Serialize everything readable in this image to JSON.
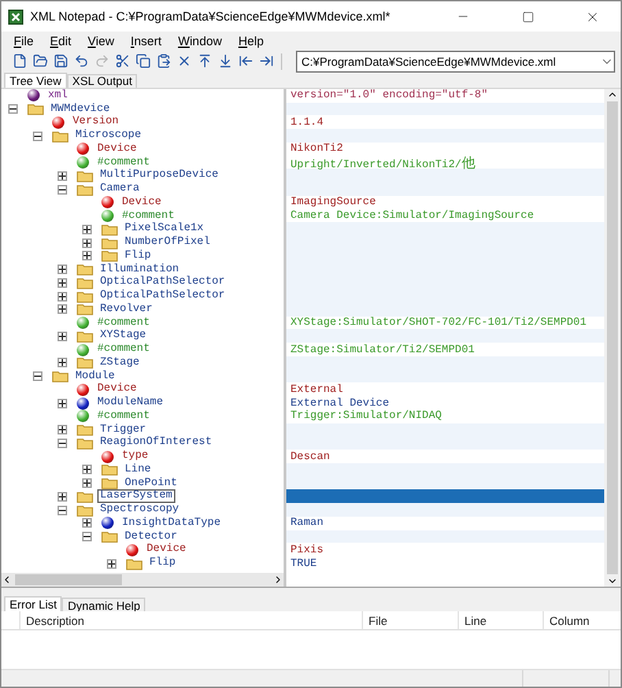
{
  "window": {
    "title": "XML Notepad - C:¥ProgramData¥ScienceEdge¥MWMdevice.xml*"
  },
  "menu": [
    "File",
    "Edit",
    "View",
    "Insert",
    "Window",
    "Help"
  ],
  "toolbar": [
    {
      "kind": "new",
      "disabled": false
    },
    {
      "kind": "open",
      "disabled": false
    },
    {
      "kind": "save",
      "disabled": false
    },
    {
      "kind": "undo",
      "disabled": false
    },
    {
      "kind": "redo",
      "disabled": true
    },
    {
      "kind": "cut",
      "disabled": false
    },
    {
      "kind": "copy",
      "disabled": false
    },
    {
      "kind": "paste",
      "disabled": false
    },
    {
      "kind": "delete",
      "disabled": false
    },
    {
      "kind": "up",
      "disabled": false
    },
    {
      "kind": "down",
      "disabled": false
    },
    {
      "kind": "left",
      "disabled": false
    },
    {
      "kind": "right",
      "disabled": false
    }
  ],
  "location": {
    "value": "C:¥ProgramData¥ScienceEdge¥MWMdevice.xml"
  },
  "tabs": [
    {
      "label": "Tree View",
      "selected": true
    },
    {
      "label": "XSL Output",
      "selected": false
    }
  ],
  "tree": [
    {
      "name": "xml",
      "kind": "pi",
      "value": "version=\"1.0\" encoding=\"utf-8\"",
      "selected": false
    },
    {
      "name": "MWMdevice",
      "kind": "element",
      "expanded": true,
      "selected": false,
      "children": [
        {
          "name": "Version",
          "kind": "attribute",
          "value": "1.1.4",
          "selected": false
        },
        {
          "name": "Microscope",
          "kind": "element",
          "expanded": true,
          "selected": false,
          "children": [
            {
              "name": "Device",
              "kind": "attribute",
              "value": "NikonTi2",
              "selected": false
            },
            {
              "name": "#comment",
              "kind": "comment",
              "value": "Upright/Inverted/NikonTi2/他",
              "selected": false
            },
            {
              "name": "MultiPurposeDevice",
              "kind": "element",
              "expanded": false,
              "selected": false
            },
            {
              "name": "Camera",
              "kind": "element",
              "expanded": true,
              "selected": false,
              "children": [
                {
                  "name": "Device",
                  "kind": "attribute",
                  "value": "ImagingSource",
                  "selected": false
                },
                {
                  "name": "#comment",
                  "kind": "comment",
                  "value": "Camera Device:Simulator/ImagingSource",
                  "selected": false
                },
                {
                  "name": "PixelScale1x",
                  "kind": "element",
                  "expanded": false,
                  "selected": false
                },
                {
                  "name": "NumberOfPixel",
                  "kind": "element",
                  "expanded": false,
                  "selected": false
                },
                {
                  "name": "Flip",
                  "kind": "element",
                  "expanded": false,
                  "selected": false
                }
              ]
            },
            {
              "name": "Illumination",
              "kind": "element",
              "expanded": false,
              "selected": false
            },
            {
              "name": "OpticalPathSelector",
              "kind": "element",
              "expanded": false,
              "selected": false
            },
            {
              "name": "OpticalPathSelector",
              "kind": "element",
              "expanded": false,
              "selected": false
            },
            {
              "name": "Revolver",
              "kind": "element",
              "expanded": false,
              "selected": false
            },
            {
              "name": "#comment",
              "kind": "comment",
              "value": "XYStage:Simulator/SHOT-702/FC-101/Ti2/SEMPD01",
              "selected": false
            },
            {
              "name": "XYStage",
              "kind": "element",
              "expanded": false,
              "selected": false
            },
            {
              "name": "#comment",
              "kind": "comment",
              "value": "ZStage:Simulator/Ti2/SEMPD01",
              "selected": false
            },
            {
              "name": "ZStage",
              "kind": "element",
              "expanded": false,
              "selected": false
            }
          ]
        },
        {
          "name": "Module",
          "kind": "element",
          "expanded": true,
          "selected": false,
          "children": [
            {
              "name": "Device",
              "kind": "attribute",
              "value": "External",
              "selected": false
            },
            {
              "name": "ModuleName",
              "kind": "text",
              "expanded": false,
              "value": "External Device",
              "selected": false
            },
            {
              "name": "#comment",
              "kind": "comment",
              "value": "Trigger:Simulator/NIDAQ",
              "selected": false
            },
            {
              "name": "Trigger",
              "kind": "element",
              "expanded": false,
              "selected": false
            },
            {
              "name": "ReagionOfInterest",
              "kind": "element",
              "expanded": true,
              "selected": false,
              "children": [
                {
                  "name": "type",
                  "kind": "attribute",
                  "value": "Descan",
                  "selected": false
                },
                {
                  "name": "Line",
                  "kind": "element",
                  "expanded": false,
                  "selected": false
                },
                {
                  "name": "OnePoint",
                  "kind": "element",
                  "expanded": false,
                  "selected": false
                }
              ]
            },
            {
              "name": "LaserSystem",
              "kind": "element",
              "expanded": false,
              "selected": true
            },
            {
              "name": "Spectroscopy",
              "kind": "element",
              "expanded": true,
              "selected": false,
              "children": [
                {
                  "name": "InsightDataType",
                  "kind": "text",
                  "expanded": false,
                  "value": "Raman",
                  "selected": false
                },
                {
                  "name": "Detector",
                  "kind": "element",
                  "expanded": true,
                  "selected": false,
                  "children": [
                    {
                      "name": "Device",
                      "kind": "attribute",
                      "value": "Pixis",
                      "selected": false
                    },
                    {
                      "name": "Flip",
                      "kind": "element",
                      "expanded": false,
                      "value": "TRUE",
                      "selected": false
                    }
                  ]
                }
              ]
            }
          ]
        }
      ]
    }
  ],
  "bottom_tabs": [
    {
      "label": "Error List",
      "selected": true
    },
    {
      "label": "Dynamic Help",
      "selected": false
    }
  ],
  "error_list": {
    "columns": [
      "Description",
      "File",
      "Line",
      "Column"
    ]
  }
}
